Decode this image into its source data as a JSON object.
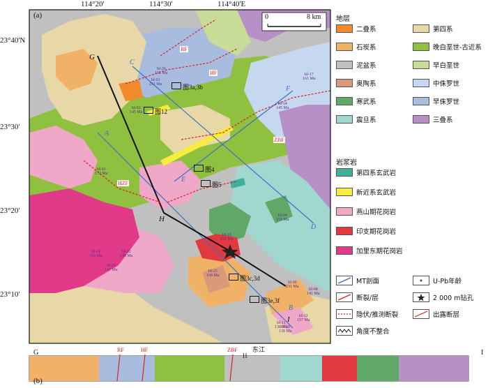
{
  "panel_a": "(a)",
  "panel_b": "(b)",
  "lon_ticks": [
    "114°20'",
    "114°30'",
    "114°40'E"
  ],
  "lat_ticks": [
    "23°40'N",
    "23°30'",
    "23°20'",
    "23°10'"
  ],
  "scale": {
    "zero": "0",
    "max": "8 km"
  },
  "colors": {
    "permian": "#f08a2c",
    "quaternary": "#e8d8a8",
    "carboniferous": "#f0b266",
    "late_cret_paleogene": "#90c040",
    "devonian": "#c0c0c0",
    "early_cret": "#c8dc98",
    "ordovician": "#d89a7a",
    "mid_jurassic": "#c6d8f0",
    "cambrian": "#60a868",
    "early_jurassic": "#a8bce0",
    "sinian": "#a0d8d0",
    "triassic": "#b890c8",
    "q_basalt": "#40b09a",
    "n_basalt": "#f8ec40",
    "yanshan": "#f0a8c8",
    "indosinian": "#e03a40",
    "caledonian": "#e03a88"
  },
  "legend": {
    "strata_title": "地层",
    "strata": [
      {
        "key": "permian",
        "label": "二叠系"
      },
      {
        "key": "quaternary",
        "label": "第四系"
      },
      {
        "key": "carboniferous",
        "label": "石炭系"
      },
      {
        "key": "late_cret_paleogene",
        "label": "晚白垩世-古近系"
      },
      {
        "key": "devonian",
        "label": "泥盆系"
      },
      {
        "key": "early_cret",
        "label": "早白垩世"
      },
      {
        "key": "ordovician",
        "label": "奥陶系"
      },
      {
        "key": "mid_jurassic",
        "label": "中侏罗世"
      },
      {
        "key": "cambrian",
        "label": "寒武系"
      },
      {
        "key": "early_jurassic",
        "label": "早侏罗世"
      },
      {
        "key": "sinian",
        "label": "震旦系"
      },
      {
        "key": "triassic",
        "label": "三叠系"
      }
    ],
    "magmatic_title": "岩浆岩",
    "magmatic": [
      {
        "key": "q_basalt",
        "label": "第四系玄武岩"
      },
      {
        "key": "n_basalt",
        "label": "新近系玄武岩"
      },
      {
        "key": "yanshan",
        "label": "燕山期花岗岩"
      },
      {
        "key": "indosinian",
        "label": "印支期花岗岩"
      },
      {
        "key": "caledonian",
        "label": "加里东期花岗岩"
      }
    ],
    "symbols": {
      "mt": "MT剖面",
      "upb": "U-Pb年龄",
      "upb_age": "169 Ma",
      "upb_id": "Id-25",
      "fault": "断裂/层",
      "drill": "2 000 m钻孔",
      "buried": "隐伏/推测断裂",
      "outcrop": "出露断层",
      "unconf": "角度不整合"
    }
  },
  "faults": [
    "RF",
    "HF",
    "ZBF",
    "HZF"
  ],
  "section_letters": [
    "A",
    "B",
    "C",
    "D",
    "E",
    "F",
    "G",
    "H",
    "I"
  ],
  "figure_boxes": [
    "图3a,3b",
    "图12",
    "图4",
    "图5",
    "图3c,3d",
    "图3e,3f"
  ],
  "samples": [
    {
      "id": "Id-26",
      "age": "152 Ma"
    },
    {
      "id": "Id-03",
      "age": "211 Ma"
    },
    {
      "id": "Id-02",
      "age": "145 Ma"
    },
    {
      "id": "Id-17",
      "age": "161 Ma"
    },
    {
      "id": "Id-14",
      "age": "145 Ma"
    },
    {
      "id": "Id-01",
      "age": "172 Ma"
    },
    {
      "id": "Id-04",
      "age": "155 Ma"
    },
    {
      "id": "Id-10",
      "age": "232 Ma"
    },
    {
      "id": "Id-24",
      "age": "143 Ma"
    },
    {
      "id": "Id-22",
      "age": "140 Ma"
    },
    {
      "id": "Id-20",
      "age": "147 Ma"
    },
    {
      "id": "Id-25",
      "age": "169 Ma"
    },
    {
      "id": "Id-06",
      "age": "231 Ma"
    },
    {
      "id": "Id-08",
      "age": "141 Ma"
    },
    {
      "id": "Id-11",
      "age": "138 Ma"
    },
    {
      "id": "Id-12",
      "age": "157 Ma"
    },
    {
      "id": "Id-10",
      "age": "139 Ma"
    }
  ],
  "section_b": {
    "left": "G",
    "right": "I",
    "h": "H",
    "river": "东江",
    "faults": [
      "RF",
      "HF",
      "ZBF"
    ]
  }
}
